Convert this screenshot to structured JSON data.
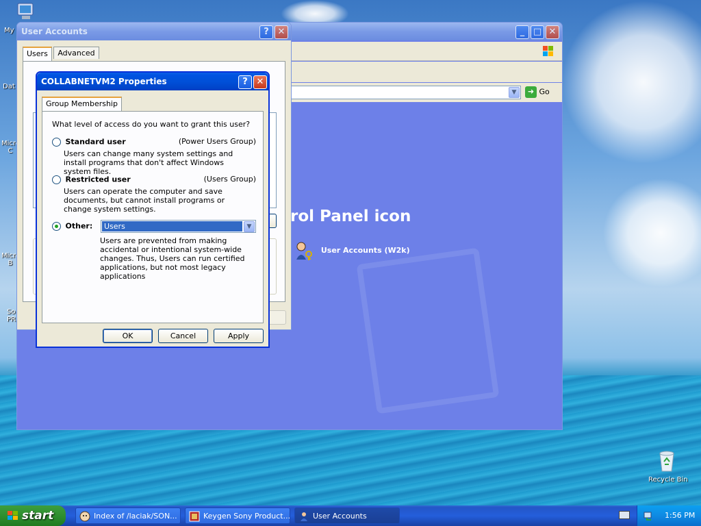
{
  "desktop": {
    "icons": [
      {
        "label": "My",
        "name": "my-computer"
      },
      {
        "label": "Dat",
        "name": "data"
      },
      {
        "label": "Micro\nC",
        "name": "micro-c"
      },
      {
        "label": "Micro\nB",
        "name": "micro-b"
      },
      {
        "label": "So\nPR",
        "name": "so-pr"
      },
      {
        "label": "Recycle Bin",
        "name": "recycle-bin"
      }
    ]
  },
  "explorer": {
    "address_go_label": "Go",
    "content_heading": "trol Panel icon",
    "item_label": "User Accounts (W2k)"
  },
  "user_accounts": {
    "title": "User Accounts",
    "tabs": [
      "Users",
      "Advanced"
    ]
  },
  "dialog": {
    "title": "COLLABNETVM2 Properties",
    "tab": "Group Membership",
    "question": "What level of access do you want to grant this user?",
    "options": [
      {
        "label": "Standard user",
        "group": "(Power Users Group)",
        "desc": "Users can change many system settings and install programs that don't affect Windows system files.",
        "selected": false
      },
      {
        "label": "Restricted user",
        "group": "(Users Group)",
        "desc": "Users can operate the computer and save documents, but cannot install programs or change system settings.",
        "selected": false
      },
      {
        "label": "Other:",
        "selected": true
      }
    ],
    "other_select_value": "Users",
    "other_desc": "Users are prevented from making accidental or intentional system-wide changes.  Thus, Users can run certified applications, but not most legacy applications",
    "buttons": {
      "ok": "OK",
      "cancel": "Cancel",
      "apply": "Apply"
    }
  },
  "taskbar": {
    "start_label": "start",
    "tasks": [
      {
        "label": "Index of /laciak/SON...",
        "active": false
      },
      {
        "label": "Keygen Sony Product...",
        "active": false
      },
      {
        "label": "User Accounts",
        "active": true
      }
    ],
    "clock": "1:56 PM"
  },
  "colors": {
    "titlebar_active": "#0054e3",
    "explorer_content": "#6d80e8",
    "window_face": "#ece9d8",
    "start_green": "#2f8f2f",
    "selection": "#316ac5"
  }
}
